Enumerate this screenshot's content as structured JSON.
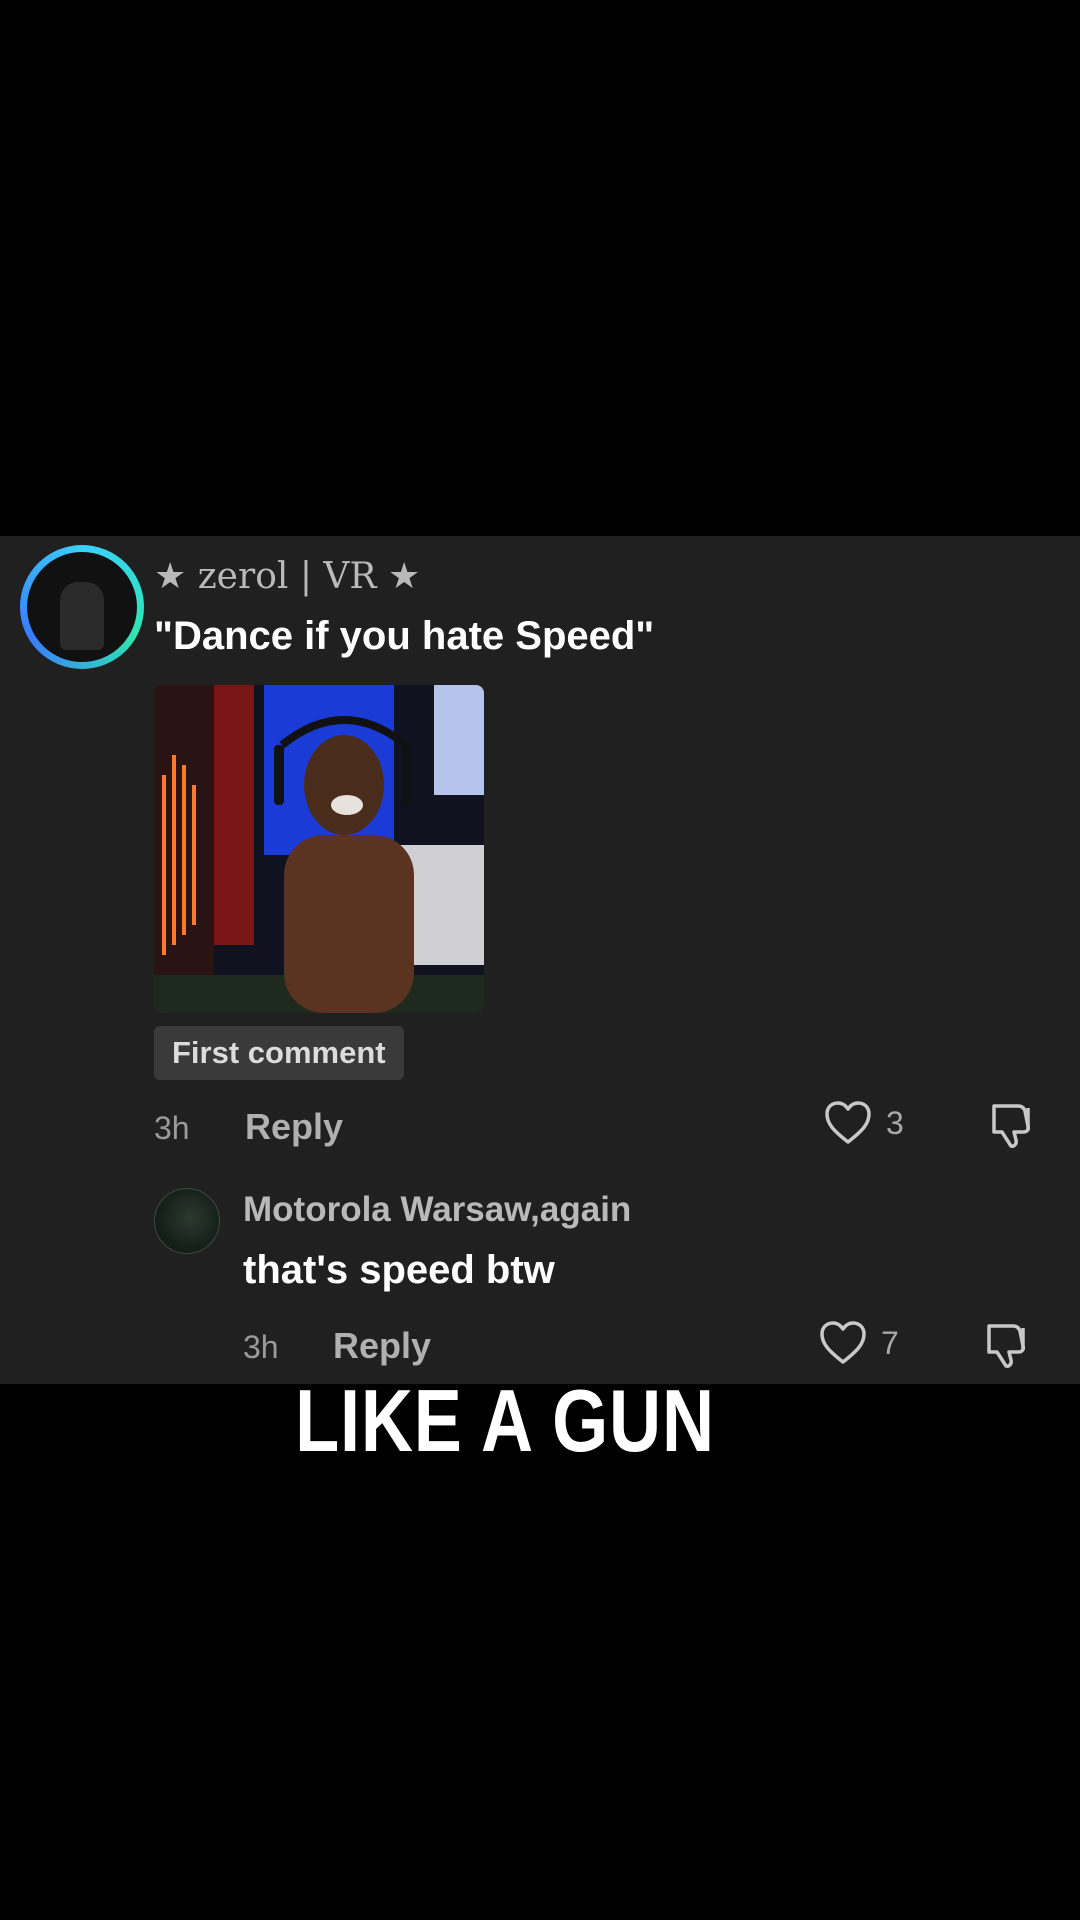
{
  "comment": {
    "author": "★ zerol | VR ★",
    "text": "\"Dance if you hate Speed\"",
    "badge": "First comment",
    "time": "3h",
    "reply_label": "Reply",
    "likes": "3"
  },
  "reply": {
    "author": "Motorola Warsaw,again",
    "text": "that's speed btw",
    "time": "3h",
    "reply_label": "Reply",
    "likes": "7"
  },
  "caption": "LIKE A GUN",
  "colors": {
    "panel_bg": "#202020",
    "page_bg": "#000000",
    "avatar_ring": "#3ad0ff"
  },
  "icons": [
    "heart-icon",
    "dislike-icon"
  ]
}
